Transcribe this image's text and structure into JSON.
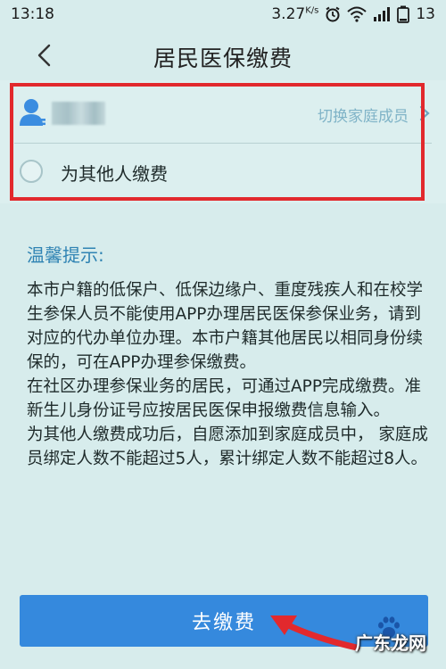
{
  "status_bar": {
    "time": "13:18",
    "speed": "3.27",
    "speed_unit": "K/s",
    "battery": "13"
  },
  "nav": {
    "title": "居民医保缴费"
  },
  "member": {
    "switch_label": "切换家庭成员"
  },
  "other": {
    "label": "为其他人缴费"
  },
  "tips": {
    "title": "温馨提示:",
    "paragraphs": [
      "本市户籍的低保户、低保边缘户、重度残疾人和在校学生参保人员不能使用APP办理居民医保参保业务，请到对应的代办单位办理。本市户籍其他居民以相同身份续保的，可在APP办理参保缴费。",
      "在社区办理参保业务的居民，可通过APP完成缴费。准新生儿身份证号应按居民医保申报缴费信息输入。",
      "为其他人缴费成功后，自愿添加到家庭成员中， 家庭成员绑定人数不能超过5人，累计绑定人数不能超过8人。"
    ]
  },
  "pay_button": {
    "label": "去缴费"
  },
  "watermark": {
    "text": "广东龙网"
  },
  "colors": {
    "background": "#d7ecec",
    "accent": "#3589dd",
    "highlight_red": "#e2292d",
    "tip_blue": "#2f83b3"
  },
  "icons": [
    "chevron-left-icon",
    "user-icon",
    "chevron-right-icon",
    "radio-icon",
    "alarm-icon",
    "wifi-icon",
    "signal-icon",
    "battery-icon",
    "red-arrow-icon",
    "paw-icon"
  ]
}
